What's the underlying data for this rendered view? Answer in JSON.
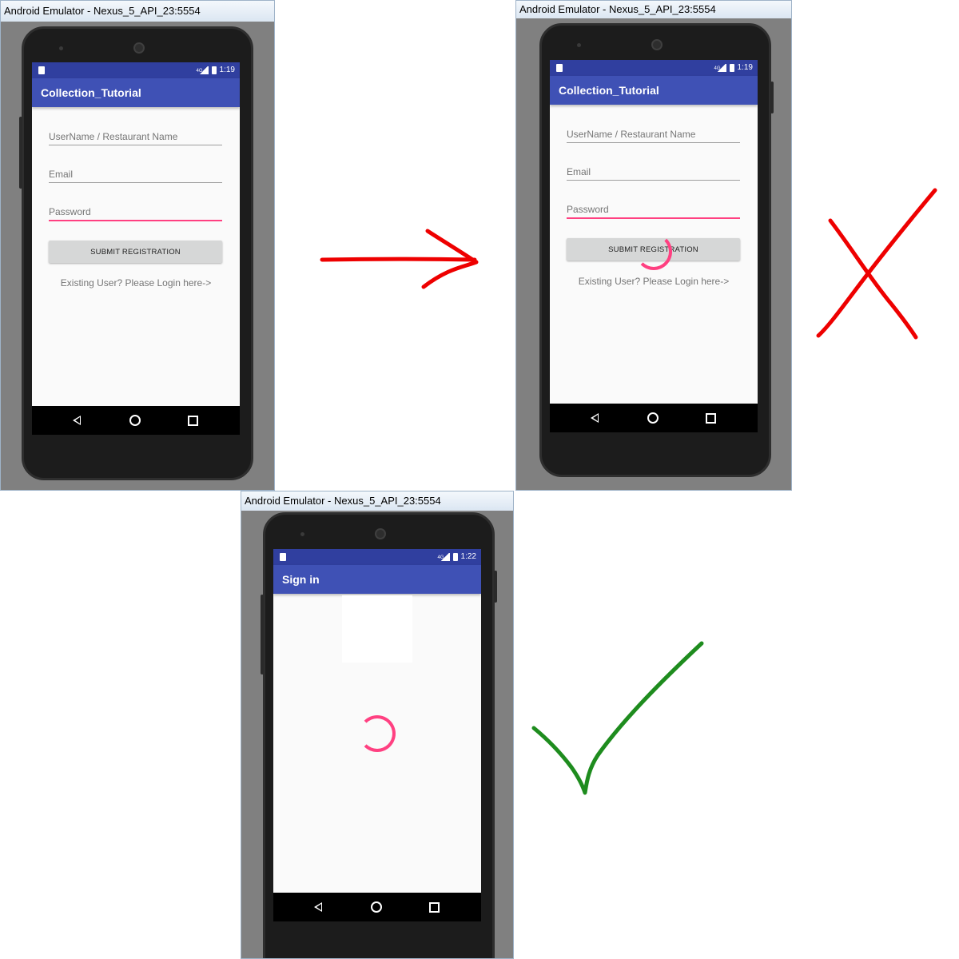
{
  "emulator_title": "Android Emulator - Nexus_5_API_23:5554",
  "panels": [
    {
      "status_time": "1:19",
      "network_type": "4G",
      "app_title": "Collection_Tutorial",
      "fields": [
        {
          "placeholder": "UserName / Restaurant Name",
          "focused": false
        },
        {
          "placeholder": "Email",
          "focused": false
        },
        {
          "placeholder": "Password",
          "focused": true
        }
      ],
      "submit_label": "SUBMIT REGISTRATION",
      "login_link": "Existing User? Please Login here->"
    },
    {
      "status_time": "1:19",
      "network_type": "4G",
      "app_title": "Collection_Tutorial",
      "fields": [
        {
          "placeholder": "UserName / Restaurant Name",
          "focused": false
        },
        {
          "placeholder": "Email",
          "focused": false
        },
        {
          "placeholder": "Password",
          "focused": true
        }
      ],
      "submit_label": "SUBMIT REGISTRATION",
      "login_link": "Existing User? Please Login here->",
      "loading": true
    },
    {
      "status_time": "1:22",
      "network_type": "4G",
      "app_title": "Sign in",
      "loading": true
    }
  ],
  "icons": {
    "arrow": "right-arrow-icon",
    "cross": "red-x-icon",
    "check": "green-checkmark-icon"
  },
  "colors": {
    "primary": "#3f51b5",
    "primary_dark": "#303f9f",
    "accent": "#ff4081",
    "arrow": "#ee0000",
    "cross": "#ee0000",
    "check": "#1e8c1e"
  }
}
